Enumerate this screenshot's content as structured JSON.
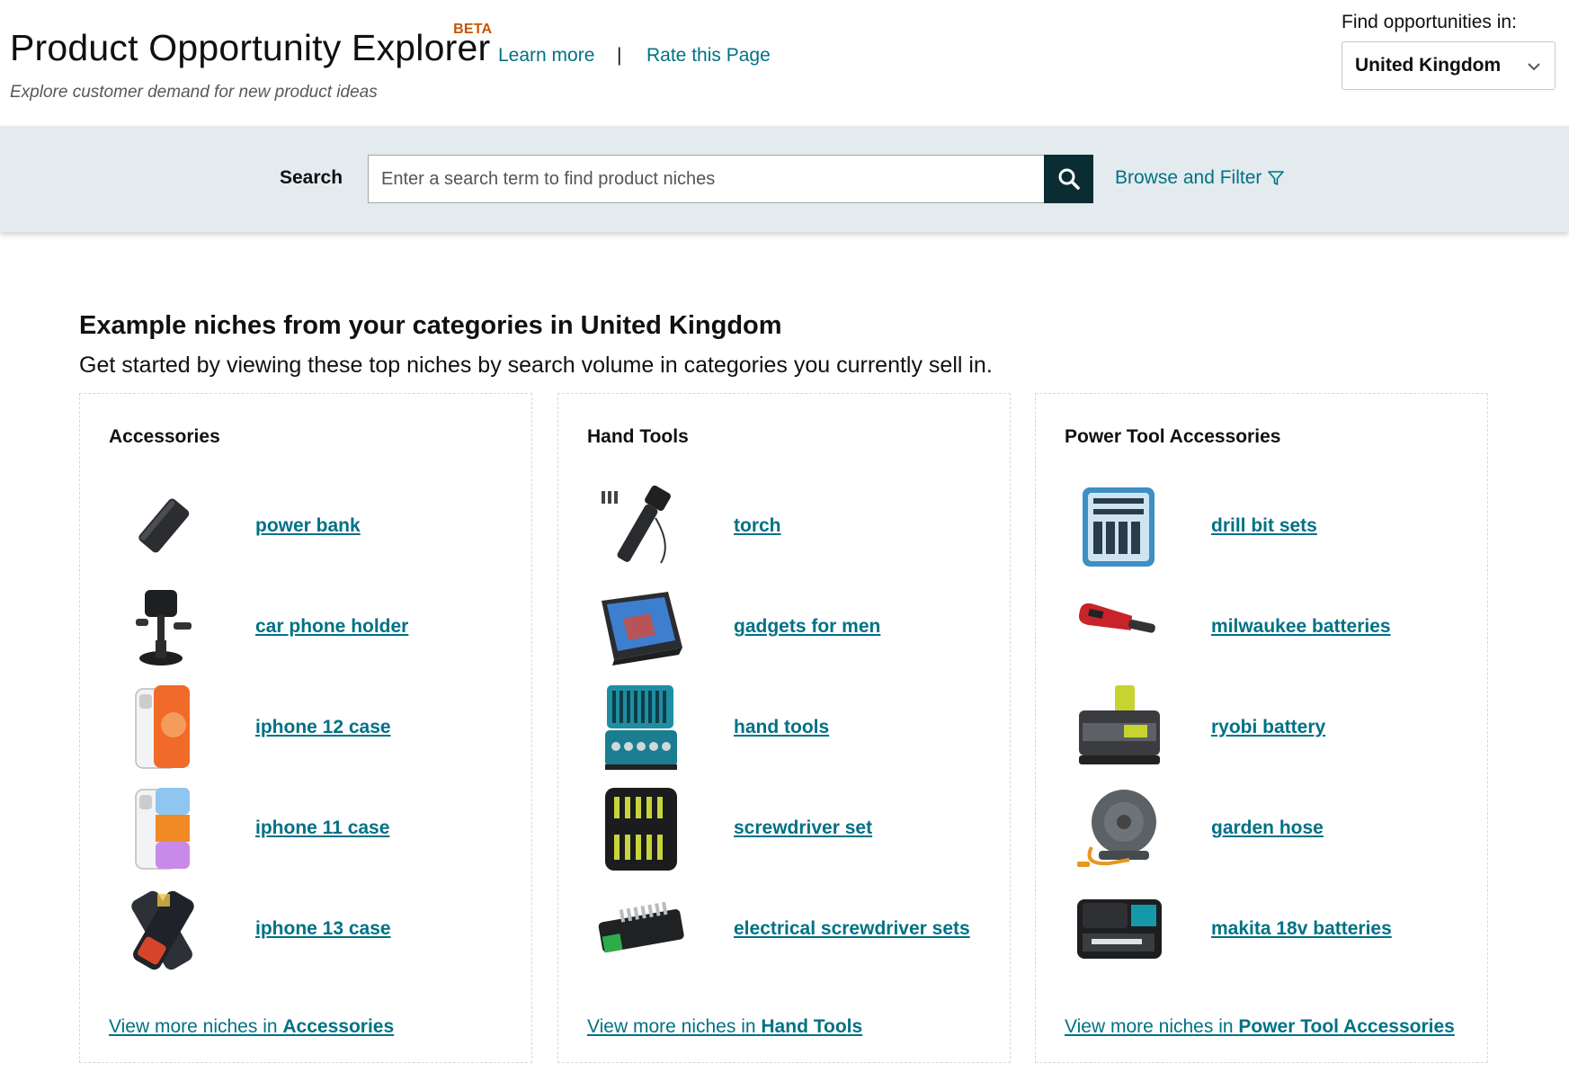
{
  "header": {
    "title": "Product Opportunity Explorer",
    "badge": "BETA",
    "subtitle": "Explore customer demand for new product ideas",
    "learn_more": "Learn more",
    "separator": "|",
    "rate_page": "Rate this Page",
    "country_label": "Find opportunities in:",
    "country_value": "United Kingdom"
  },
  "search": {
    "label": "Search",
    "placeholder": "Enter a search term to find product niches",
    "value": "",
    "browse_filter": "Browse and Filter"
  },
  "intro": {
    "title": "Example niches from your categories in United Kingdom",
    "subtitle": "Get started by viewing these top niches by search volume in categories you currently sell in."
  },
  "categories": [
    {
      "name": "Accessories",
      "more_prefix": "View more niches in",
      "niches": [
        {
          "label": "power bank",
          "icon": "power-bank-image"
        },
        {
          "label": "car phone holder",
          "icon": "car-phone-holder-image"
        },
        {
          "label": "iphone 12 case",
          "icon": "iphone-12-case-image"
        },
        {
          "label": "iphone 11 case",
          "icon": "iphone-11-case-image"
        },
        {
          "label": "iphone 13 case",
          "icon": "iphone-13-case-image"
        }
      ]
    },
    {
      "name": "Hand Tools",
      "more_prefix": "View more niches in",
      "niches": [
        {
          "label": "torch",
          "icon": "torch-image"
        },
        {
          "label": "gadgets for men",
          "icon": "phone-magnifier-image"
        },
        {
          "label": "hand tools",
          "icon": "tool-case-image"
        },
        {
          "label": "screwdriver set",
          "icon": "screwdriver-set-image"
        },
        {
          "label": "electrical screwdriver sets",
          "icon": "bit-set-image"
        }
      ]
    },
    {
      "name": "Power Tool Accessories",
      "more_prefix": "View more niches in",
      "niches": [
        {
          "label": "drill bit sets",
          "icon": "drill-bit-case-image"
        },
        {
          "label": "milwaukee batteries",
          "icon": "multitool-image"
        },
        {
          "label": "ryobi battery",
          "icon": "battery-charger-image"
        },
        {
          "label": "garden hose",
          "icon": "hose-reel-image"
        },
        {
          "label": "makita 18v batteries",
          "icon": "battery-pack-image"
        }
      ]
    }
  ],
  "colors": {
    "link": "#007185",
    "search_button": "#0a2d33",
    "band": "#e3ebee",
    "beta": "#c45500"
  }
}
